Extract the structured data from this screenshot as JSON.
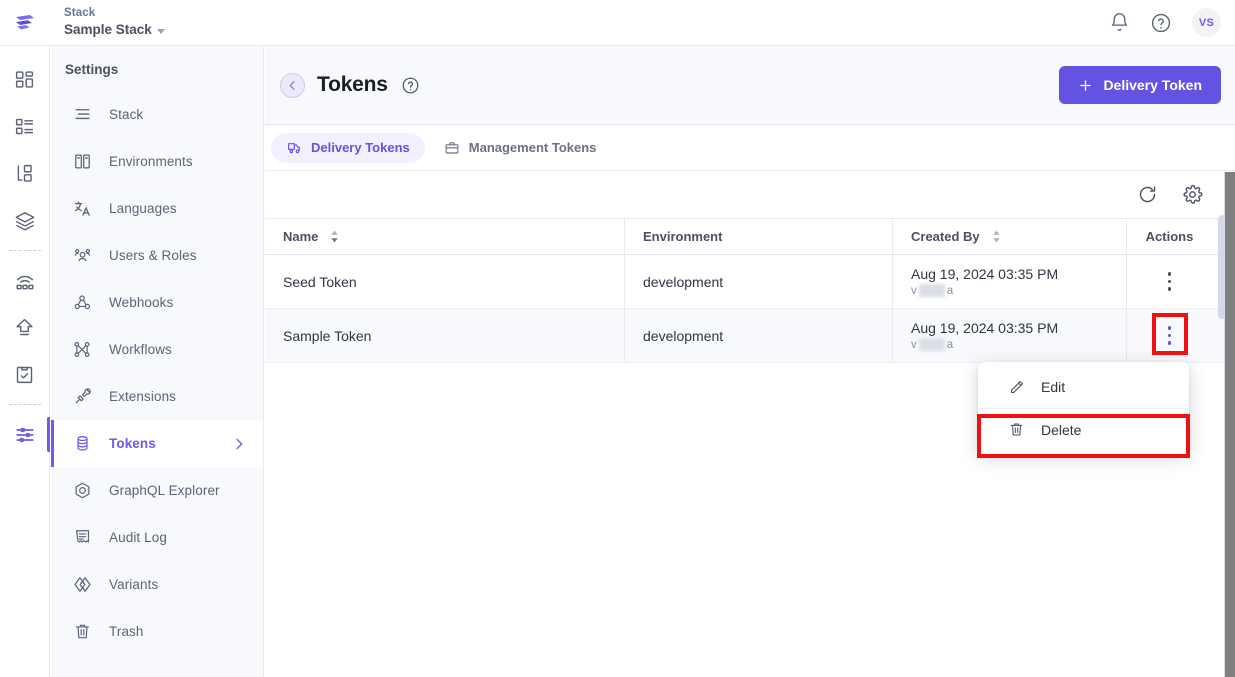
{
  "topbar": {
    "logo_icon": "contentstack-logo-icon",
    "stack_label": "Stack",
    "stack_name": "Sample Stack",
    "notifications_icon": "bell-icon",
    "help_icon": "question-circle-icon",
    "avatar_initials": "VS"
  },
  "rail": {
    "items": [
      {
        "icon": "dashboard-icon",
        "name": "rail-item-dashboard",
        "active": false
      },
      {
        "icon": "content-types-icon",
        "name": "rail-item-content-types",
        "active": false
      },
      {
        "icon": "content-models-icon",
        "name": "rail-item-entries",
        "active": false
      },
      {
        "icon": "assets-layers-icon",
        "name": "rail-item-assets",
        "active": false
      },
      {
        "icon": "releases-icon",
        "name": "rail-item-releases",
        "active": false
      },
      {
        "icon": "publish-queue-icon",
        "name": "rail-item-publish-queue",
        "active": false
      },
      {
        "icon": "bulk-tasks-clipboard-icon",
        "name": "rail-item-bulk-tasks",
        "active": false
      },
      {
        "icon": "settings-sliders-icon",
        "name": "rail-item-settings",
        "active": true
      }
    ]
  },
  "sidebar": {
    "title": "Settings",
    "items": [
      {
        "label": "Stack",
        "icon": "stack-icon",
        "active": false
      },
      {
        "label": "Environments",
        "icon": "environments-icon",
        "active": false
      },
      {
        "label": "Languages",
        "icon": "languages-icon",
        "active": false
      },
      {
        "label": "Users & Roles",
        "icon": "users-roles-icon",
        "active": false
      },
      {
        "label": "Webhooks",
        "icon": "webhooks-icon",
        "active": false
      },
      {
        "label": "Workflows",
        "icon": "workflows-icon",
        "active": false
      },
      {
        "label": "Extensions",
        "icon": "extensions-plug-icon",
        "active": false
      },
      {
        "label": "Tokens",
        "icon": "tokens-database-icon",
        "active": true
      },
      {
        "label": "GraphQL Explorer",
        "icon": "graphql-icon",
        "active": false
      },
      {
        "label": "Audit Log",
        "icon": "audit-log-icon",
        "active": false
      },
      {
        "label": "Variants",
        "icon": "variants-icon",
        "active": false
      },
      {
        "label": "Trash",
        "icon": "trash-icon",
        "active": false
      }
    ]
  },
  "page": {
    "back_icon": "chevron-left-icon",
    "title": "Tokens",
    "help_icon": "question-circle-icon",
    "primary_button": {
      "label": "Delivery Token",
      "icon": "plus-icon",
      "color": "#6254e0"
    }
  },
  "tabs": [
    {
      "label": "Delivery Tokens",
      "icon": "delivery-token-icon",
      "active": true
    },
    {
      "label": "Management Tokens",
      "icon": "briefcase-icon",
      "active": false
    }
  ],
  "toolbar": {
    "refresh_icon": "refresh-icon",
    "settings_icon": "gear-icon"
  },
  "table": {
    "columns": [
      {
        "label": "Name",
        "sortable": true
      },
      {
        "label": "Environment",
        "sortable": false
      },
      {
        "label": "Created By",
        "sortable": true
      },
      {
        "label": "Actions",
        "sortable": false
      }
    ],
    "rows": [
      {
        "name": "Seed Token",
        "environment": "development",
        "created_date": "Aug 19, 2024 03:35 PM",
        "created_by_prefix": "v",
        "created_by_suffix": "a",
        "created_by_redacted": true,
        "menu_open": false
      },
      {
        "name": "Sample Token",
        "environment": "development",
        "created_date": "Aug 19, 2024 03:35 PM",
        "created_by_prefix": "v",
        "created_by_suffix": "a",
        "created_by_redacted": true,
        "menu_open": true
      }
    ]
  },
  "context_menu": {
    "items": [
      {
        "label": "Edit",
        "icon": "pencil-icon",
        "highlighted": false
      },
      {
        "label": "Delete",
        "icon": "trash-icon",
        "highlighted": true
      }
    ]
  },
  "annotations": {
    "color": "#ee1111",
    "boxes": [
      {
        "target": "row-actions-kebab-button"
      },
      {
        "target": "context-menu-item-delete"
      }
    ]
  }
}
